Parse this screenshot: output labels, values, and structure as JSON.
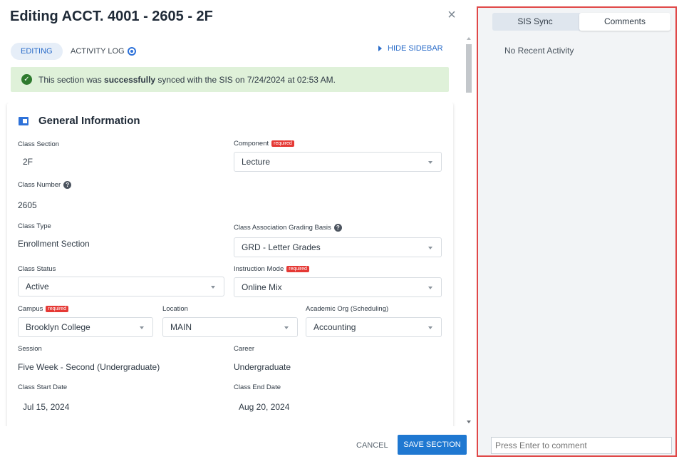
{
  "header": {
    "title": "Editing ACCT. 4001 - 2605 - 2F",
    "close": "×"
  },
  "tabs": {
    "editing": "EDITING",
    "activity_log": "ACTIVITY LOG",
    "hide_sidebar": "HIDE SIDEBAR"
  },
  "banner": {
    "prefix": "This section was ",
    "emphasis": "successfully",
    "suffix": " synced with the SIS on 7/24/2024 at 02:53 AM.",
    "color": "#dff1d9"
  },
  "card": {
    "title": "General Information",
    "required_badge": "required",
    "help_icon": "?",
    "fields": {
      "class_section": {
        "label": "Class Section",
        "value": "2F"
      },
      "component": {
        "label": "Component",
        "value": "Lecture"
      },
      "class_number": {
        "label": "Class Number",
        "value": "2605"
      },
      "class_type": {
        "label": "Class Type",
        "value": "Enrollment Section"
      },
      "grading_basis": {
        "label": "Class Association Grading Basis",
        "value": "GRD - Letter Grades"
      },
      "class_status": {
        "label": "Class Status",
        "value": "Active"
      },
      "instruction_mode": {
        "label": "Instruction Mode",
        "value": "Online Mix"
      },
      "campus": {
        "label": "Campus",
        "value": "Brooklyn College"
      },
      "location": {
        "label": "Location",
        "value": "MAIN"
      },
      "academic_org": {
        "label": "Academic Org (Scheduling)",
        "value": "Accounting"
      },
      "session": {
        "label": "Session",
        "value": "Five Week - Second (Undergraduate)"
      },
      "career": {
        "label": "Career",
        "value": "Undergraduate"
      },
      "start_date": {
        "label": "Class Start Date",
        "value": "Jul 15, 2024"
      },
      "end_date": {
        "label": "Class End Date",
        "value": "Aug 20, 2024"
      }
    }
  },
  "footer": {
    "cancel": "CANCEL",
    "save": "SAVE SECTION",
    "accent": "#1f78d1"
  },
  "sidebar": {
    "tabs": [
      "SIS Sync",
      "Comments"
    ],
    "active_tab": "Comments",
    "empty_text": "No Recent Activity",
    "comment_placeholder": "Press Enter to comment",
    "border_color": "#e04848"
  },
  "icons": {
    "close": "close-icon",
    "activity": "radio-dot-icon",
    "hide": "triangle-right-icon",
    "success": "check-circle-icon",
    "section": "panel-icon",
    "help": "help-circle-icon",
    "caret": "caret-down-icon"
  }
}
